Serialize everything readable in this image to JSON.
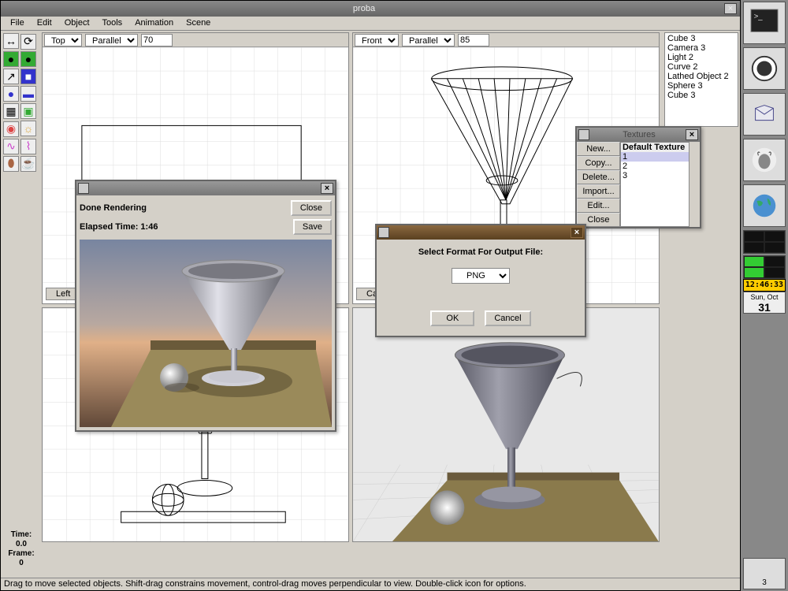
{
  "window": {
    "title": "proba"
  },
  "menus": [
    "File",
    "Edit",
    "Object",
    "Tools",
    "Animation",
    "Scene"
  ],
  "viewports": {
    "topleft": {
      "view": "Top",
      "proj": "Parallel",
      "zoom": "70",
      "label": "Left"
    },
    "topright": {
      "view": "Front",
      "proj": "Parallel",
      "zoom": "85",
      "label": "Came"
    }
  },
  "scene_items": [
    "Cube 3",
    "Camera 3",
    "Light 2",
    "Curve 2",
    "Lathed Object 2",
    "Sphere 3",
    "Cube 3"
  ],
  "time_frame": {
    "time_label": "Time:",
    "time_value": "0.0",
    "frame_label": "Frame:",
    "frame_value": "0"
  },
  "statusbar": "Drag to move selected objects.  Shift-drag constrains movement, control-drag moves perpendicular to view.  Double-click icon for options.",
  "render_dialog": {
    "status": "Done Rendering",
    "elapsed_label": "Elapsed Time: 1:46",
    "close": "Close",
    "save": "Save"
  },
  "format_dialog": {
    "prompt": "Select Format For Output File:",
    "selected": "PNG",
    "ok": "OK",
    "cancel": "Cancel"
  },
  "textures_dialog": {
    "title": "Textures",
    "buttons": [
      "New...",
      "Copy...",
      "Delete...",
      "Import...",
      "Edit...",
      "Close"
    ],
    "list_header": "Default Texture",
    "items": [
      "1",
      "2",
      "3"
    ],
    "selected_index": 0
  },
  "dock": {
    "clock": "12:46:33",
    "date_line1": "Sun, Oct",
    "date_line2": "31",
    "workspace_num": "3"
  },
  "tools": [
    "move",
    "rotate",
    "scale",
    "cube",
    "sphere",
    "cylinder",
    "mesh",
    "material",
    "camera",
    "light",
    "curve",
    "lathed",
    "blob",
    "teapot"
  ]
}
